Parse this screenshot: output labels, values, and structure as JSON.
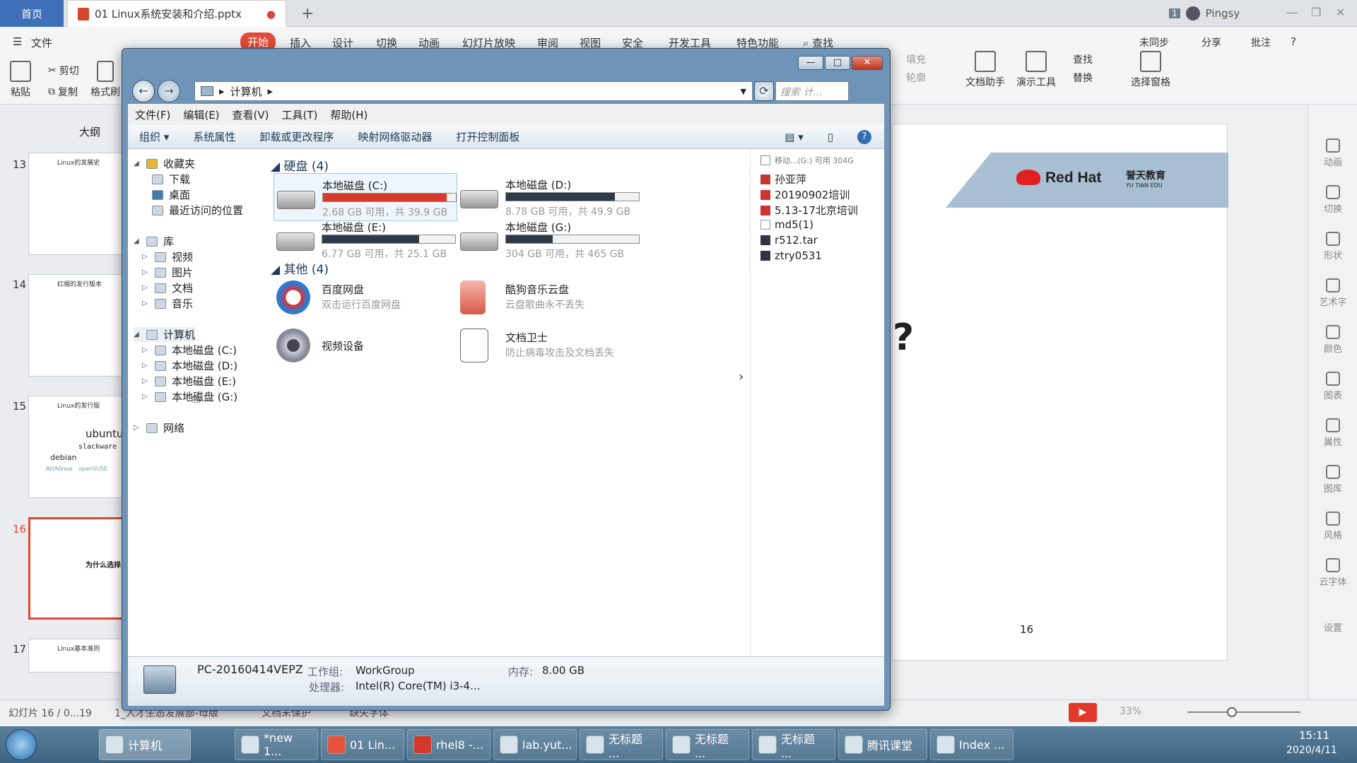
{
  "wps_tabs": {
    "home": "首页",
    "doc_title": "01 Linux系统安装和介绍.pptx",
    "user": "Pingsy",
    "badge": "1"
  },
  "ribbon": {
    "file_menu": "文件",
    "menu": [
      "开始",
      "插入",
      "设计",
      "切换",
      "动画",
      "幻灯片放映",
      "审阅",
      "视图",
      "安全",
      "开发工具",
      "特色功能",
      "查找"
    ],
    "right_actions": [
      "未同步",
      "分享",
      "批注"
    ],
    "left_buttons": [
      "粘贴",
      "剪切",
      "复制",
      "格式刷"
    ],
    "right_buttons": [
      "填充",
      "轮廓",
      "文档助手",
      "演示工具",
      "查找",
      "替换",
      "选择窗格"
    ]
  },
  "slide_panel": {
    "tab": "大纲",
    "slides": [
      {
        "num": "13",
        "title": "Linux的发展史"
      },
      {
        "num": "14",
        "title": "红帽的发行版本"
      },
      {
        "num": "15",
        "title": "Linux的发行版",
        "logos": [
          "ubuntu",
          "slackware",
          "debian",
          "Archlinux",
          "openSUSE"
        ]
      },
      {
        "num": "16",
        "title": "为什么选择"
      },
      {
        "num": "17",
        "title": "Linux基本准则"
      }
    ]
  },
  "slide": {
    "brand": "Red Hat",
    "edu": "誉天教育",
    "edu_en": "YU TIAN EDU",
    "question_mark": "?",
    "page_number": "16"
  },
  "right_sidebar": [
    "动画",
    "切换",
    "形状",
    "艺术字",
    "颜色",
    "图表",
    "属性",
    "图库",
    "风格",
    "云字体",
    "设置"
  ],
  "explorer": {
    "address": "计算机",
    "search_placeholder": "搜索 计...",
    "menu": [
      "文件(F)",
      "编辑(E)",
      "查看(V)",
      "工具(T)",
      "帮助(H)"
    ],
    "commands": [
      "组织 ▾",
      "系统属性",
      "卸载或更改程序",
      "映射网络驱动器",
      "打开控制面板"
    ],
    "nav": {
      "favorites": "收藏夹",
      "favorites_items": [
        "下载",
        "桌面",
        "最近访问的位置"
      ],
      "library": "库",
      "library_items": [
        "视频",
        "图片",
        "文档",
        "音乐"
      ],
      "computer": "计算机",
      "computer_items": [
        "本地磁盘 (C:)",
        "本地磁盘 (D:)",
        "本地磁盘 (E:)",
        "本地磁盘 (G:)"
      ],
      "network": "网络"
    },
    "groups": {
      "disks": "硬盘 (4)",
      "other": "其他 (4)"
    },
    "drives": [
      {
        "name": "本地磁盘 (C:)",
        "free": "2.68 GB 可用，共 39.9 GB",
        "used_fraction": 0.93,
        "bar_color": "#d93a2b"
      },
      {
        "name": "本地磁盘 (D:)",
        "free": "8.78 GB 可用，共 49.9 GB",
        "used_fraction": 0.82,
        "bar_color": "#2c3a4a"
      },
      {
        "name": "本地磁盘 (E:)",
        "free": "6.77 GB 可用，共 25.1 GB",
        "used_fraction": 0.73,
        "bar_color": "#2c3a4a"
      },
      {
        "name": "本地磁盘 (G:)",
        "free": "304 GB 可用，共 465 GB",
        "used_fraction": 0.35,
        "bar_color": "#2c3a4a"
      }
    ],
    "others": [
      {
        "name": "百度网盘",
        "desc": "双击运行百度网盘"
      },
      {
        "name": "酷狗音乐云盘",
        "desc": "云盘歌曲永不丢失"
      },
      {
        "name": "视频设备",
        "desc": ""
      },
      {
        "name": "文档卫士",
        "desc": "防止病毒攻击及文档丢失"
      }
    ],
    "preview_header": "移动...(G:) 可用 304G",
    "preview_items": [
      "孙亚萍",
      "20190902培训",
      "5.13-17北京培训",
      "md5(1)",
      "r512.tar",
      "ztry0531"
    ],
    "details": {
      "pc_name": "PC-20160414VEPZ",
      "workgroup_label": "工作组:",
      "workgroup": "WorkGroup",
      "memory_label": "内存:",
      "memory": "8.00 GB",
      "cpu_label": "处理器:",
      "cpu": "Intel(R) Core(TM) i3-4..."
    }
  },
  "statusbar": {
    "slide_info": "幻灯片 16 / 0...19",
    "theme": "1_人才生态发展部-母版",
    "protect": "文档未保护",
    "font": "缺失字体",
    "zoom": "33%"
  },
  "taskbar": {
    "items": [
      "计算机",
      "*new 1...",
      "01 Lin...",
      "rhel8 -...",
      "lab.yut...",
      "无标题 ...",
      "无标题 ...",
      "无标题 ...",
      "腾讯课堂",
      "Index ..."
    ],
    "time": "15:11",
    "date": "2020/4/11"
  }
}
